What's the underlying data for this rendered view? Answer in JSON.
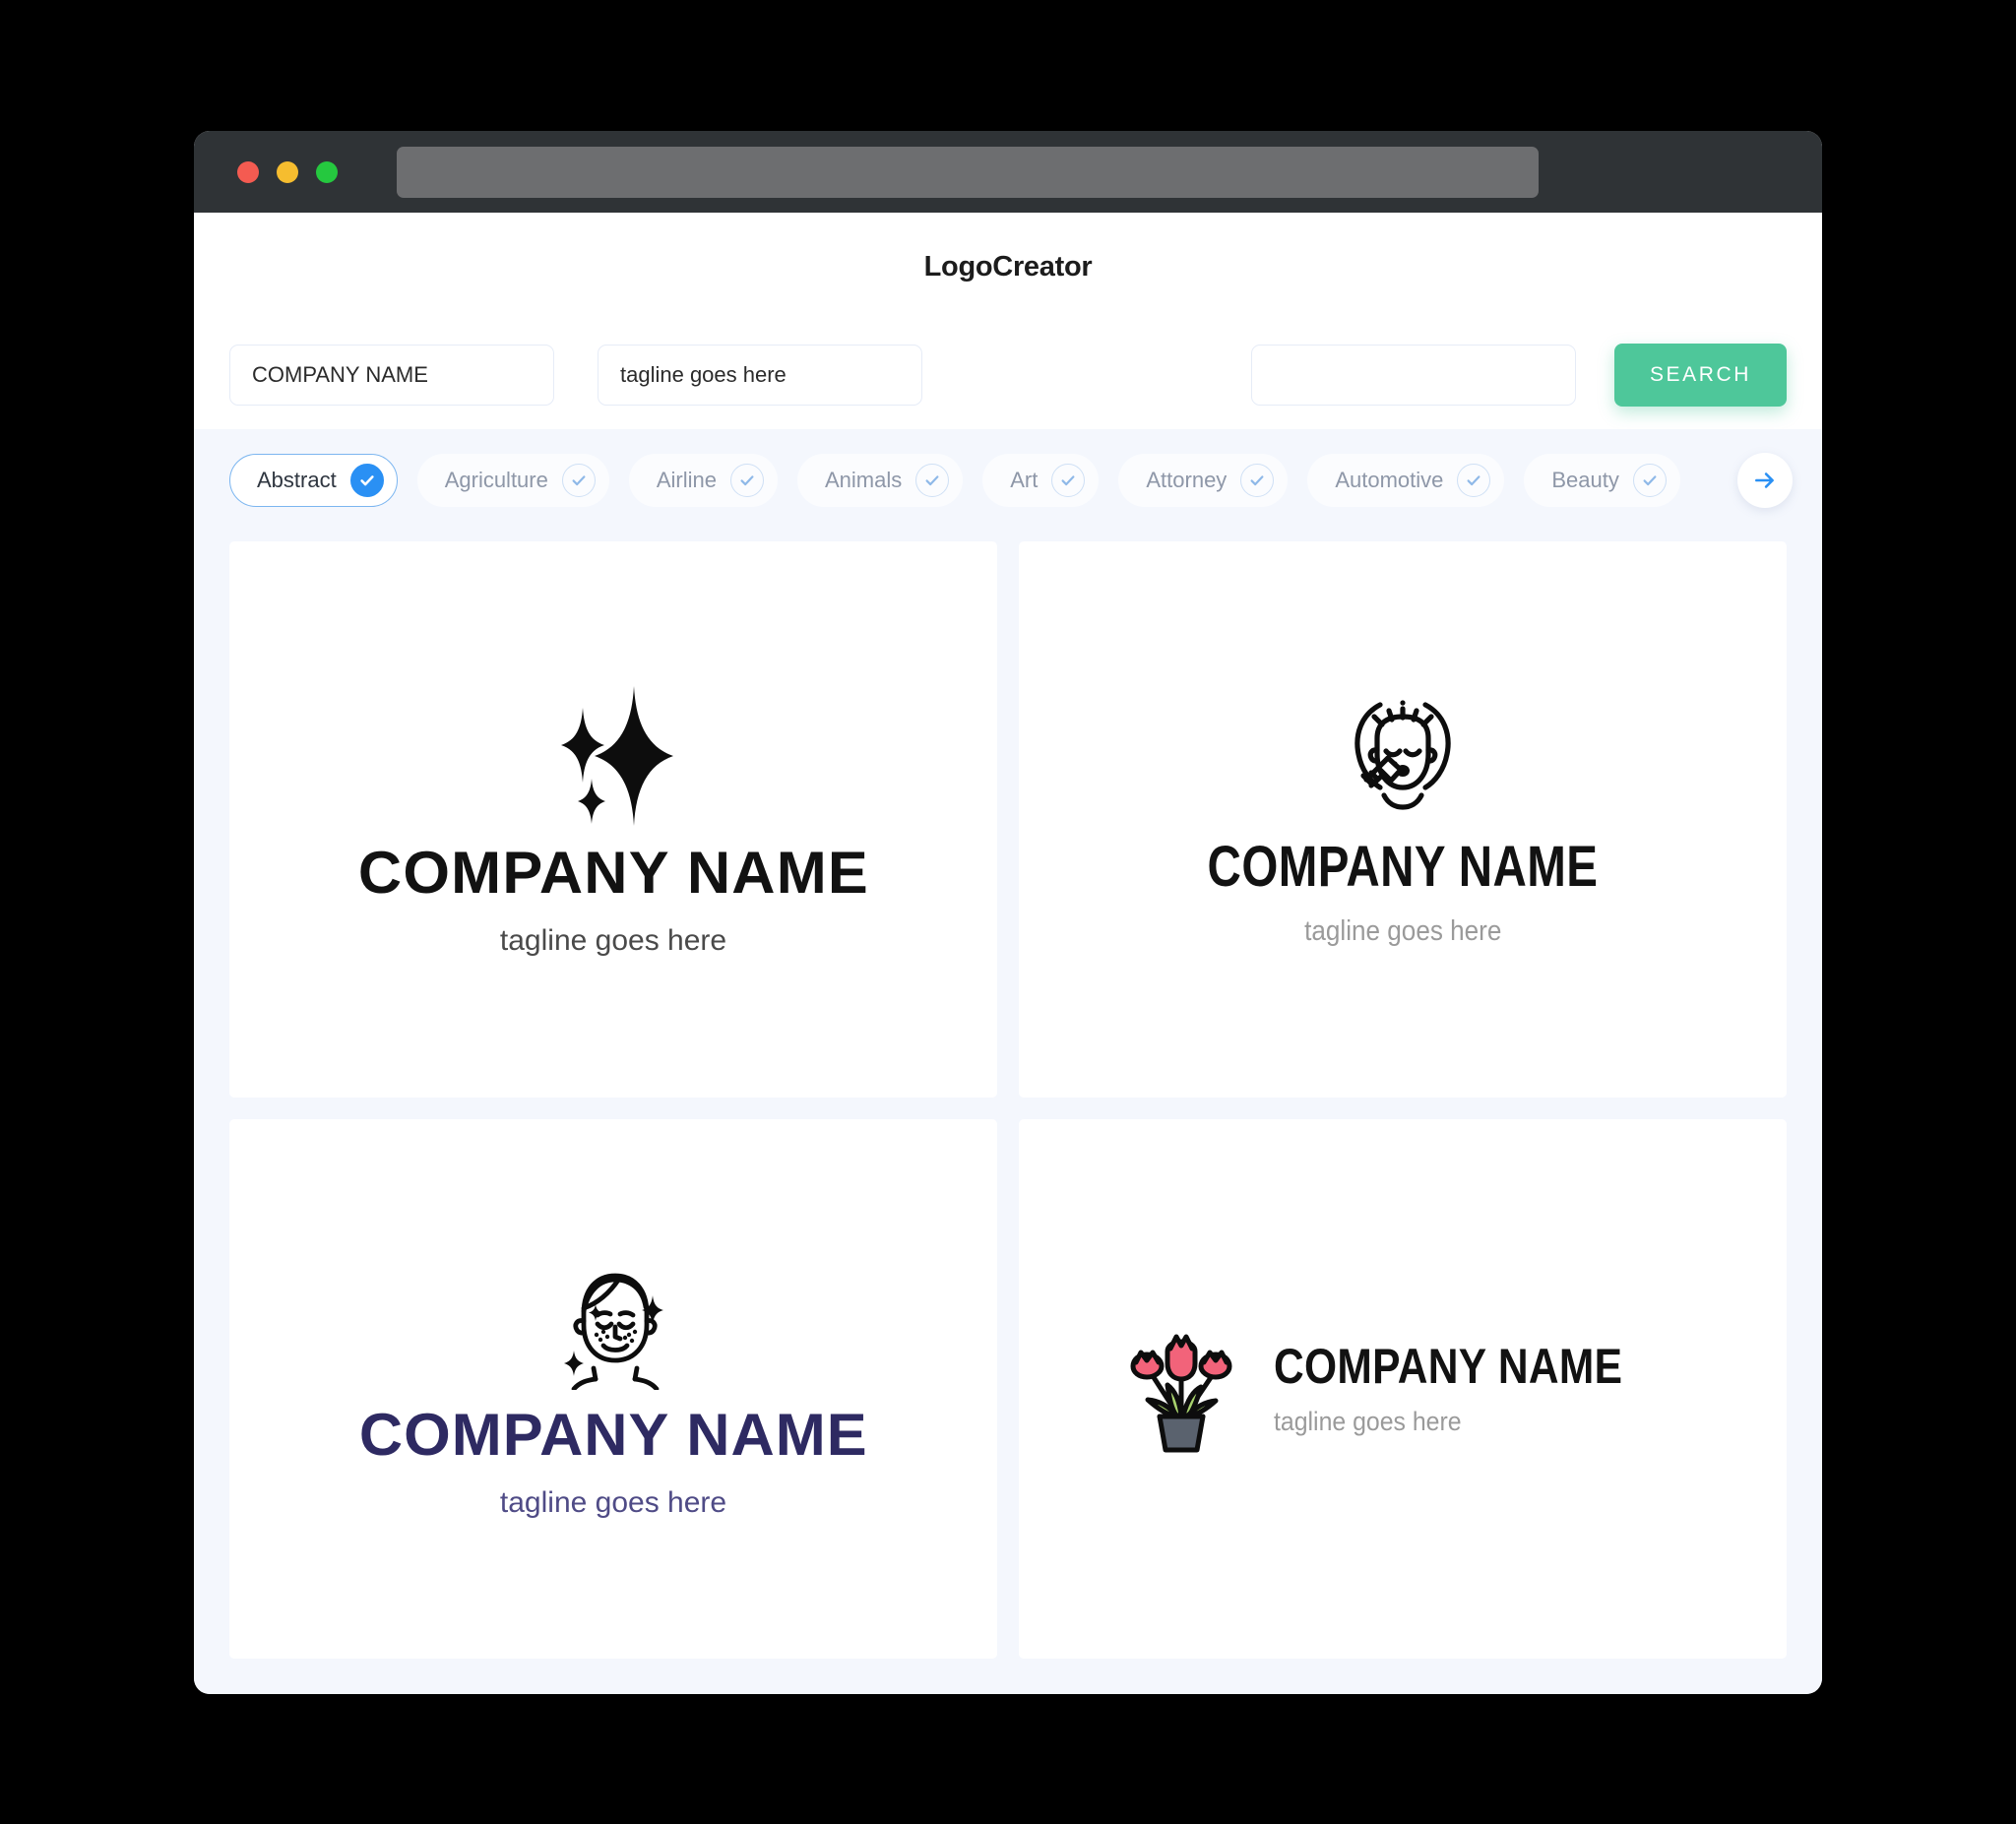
{
  "window": {
    "traffic_lights": [
      {
        "name": "close",
        "color": "#f45b51"
      },
      {
        "name": "minimize",
        "color": "#f6bd2f"
      },
      {
        "name": "maximize",
        "color": "#25c83f"
      }
    ],
    "url_bar_value": ""
  },
  "header": {
    "title": "LogoCreator"
  },
  "search": {
    "company_name_value": "COMPANY NAME",
    "company_name_placeholder": "COMPANY NAME",
    "tagline_value": "tagline goes here",
    "tagline_placeholder": "tagline goes here",
    "extra_value": "",
    "extra_placeholder": "",
    "search_label": "SEARCH",
    "search_button_color": "#4ec79a"
  },
  "categories": {
    "selected": "Abstract",
    "accent_color": "#2a90f4",
    "next_icon": "arrow-right-icon",
    "items": [
      {
        "label": "Abstract",
        "selected": true
      },
      {
        "label": "Agriculture",
        "selected": false
      },
      {
        "label": "Airline",
        "selected": false
      },
      {
        "label": "Animals",
        "selected": false
      },
      {
        "label": "Art",
        "selected": false
      },
      {
        "label": "Attorney",
        "selected": false
      },
      {
        "label": "Automotive",
        "selected": false
      },
      {
        "label": "Beauty",
        "selected": false
      }
    ]
  },
  "logos": [
    {
      "id": "card-1",
      "icon": "sparkle-stars-icon",
      "layout": "vertical",
      "name": "COMPANY NAME",
      "tagline": "tagline goes here",
      "name_color": "#121212",
      "tagline_color": "#4a4a4a"
    },
    {
      "id": "card-2",
      "icon": "face-with-syringe-icon",
      "layout": "vertical",
      "name": "COMPANY NAME",
      "tagline": "tagline goes here",
      "name_color": "#121212",
      "tagline_color": "#9a9a9a"
    },
    {
      "id": "card-3",
      "icon": "freckled-face-sparkles-icon",
      "layout": "vertical",
      "name": "COMPANY NAME",
      "tagline": "tagline goes here",
      "name_color": "#2e2a62",
      "tagline_color": "#4f4b86"
    },
    {
      "id": "card-4",
      "icon": "potted-tulips-icon",
      "layout": "horizontal",
      "name": "COMPANY NAME",
      "tagline": "tagline goes here",
      "name_color": "#121212",
      "tagline_color": "#9a9a9a",
      "flower_color": "#f2637a",
      "leaf_color": "#a8d26d",
      "pot_color": "#5a626e"
    }
  ]
}
